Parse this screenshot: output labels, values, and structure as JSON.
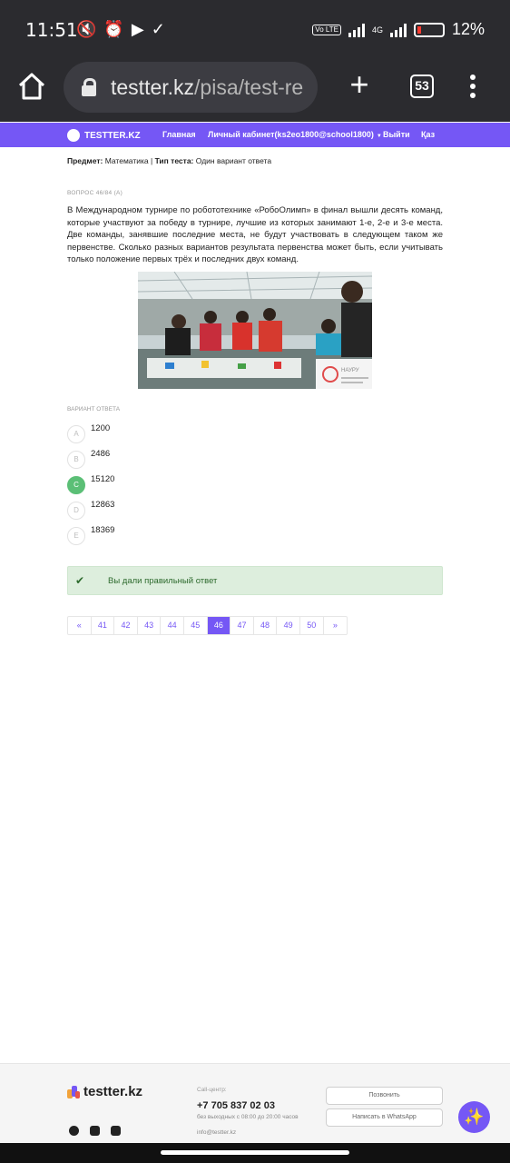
{
  "status_bar": {
    "time": "11:51",
    "network": "4G",
    "volte": "Vo LTE",
    "battery": "12%"
  },
  "browser": {
    "url_host": "testter.kz",
    "url_path": "/pisa/test-re",
    "tab_count": "53"
  },
  "site_nav": {
    "brand": "TESTTER.KZ",
    "links": [
      "Главная",
      "Личный кабинет(ks2eo1800@school1800)",
      "Выйти",
      "Қаз"
    ]
  },
  "subject_line": {
    "subject_label": "Предмет:",
    "subject_value": "Математика |",
    "type_label": "Тип теста:",
    "type_value": "Один вариант ответа"
  },
  "question": {
    "number": "ВОПРОС 46/84 (A)",
    "text": "В Международном турнире по робототехнике «РобоОлимп» в финал вышли десять команд, которые участвуют за победу в турнире, лучшие из которых занимают 1-е, 2-е и 3-е места. Две команды, занявшие последние места, не будут участвовать в следующем таком же первенстве. Сколько разных вариантов результата первенства может быть, если учитывать только положение первых трёх и последних двух команд.",
    "image_caption": "НАУРУ"
  },
  "answers": {
    "label": "ВАРИАНТ ОТВЕТА",
    "options": [
      {
        "letter": "A",
        "value": "1200"
      },
      {
        "letter": "B",
        "value": "2486"
      },
      {
        "letter": "C",
        "value": "15120"
      },
      {
        "letter": "D",
        "value": "12863"
      },
      {
        "letter": "E",
        "value": "18369"
      }
    ],
    "selected": "C"
  },
  "result": {
    "message": "Вы дали правильный ответ"
  },
  "pagination": {
    "prev": "«",
    "pages": [
      "41",
      "42",
      "43",
      "44",
      "45",
      "46",
      "47",
      "48",
      "49",
      "50"
    ],
    "next": "»",
    "active_page": "46"
  },
  "footer": {
    "brand": "testter.kz",
    "call_center_label": "Call-центр:",
    "phone": "+7 705 837 02 03",
    "hours": "без выходных с 08:00 до 20:00 часов",
    "email": "info@testter.kz",
    "call_button": "Позвонить",
    "whatsapp_button": "Написать в WhatsApp"
  },
  "colors": {
    "accent": "#7557f5",
    "correct": "#5bbf76",
    "success_bg": "#ddeedd"
  }
}
